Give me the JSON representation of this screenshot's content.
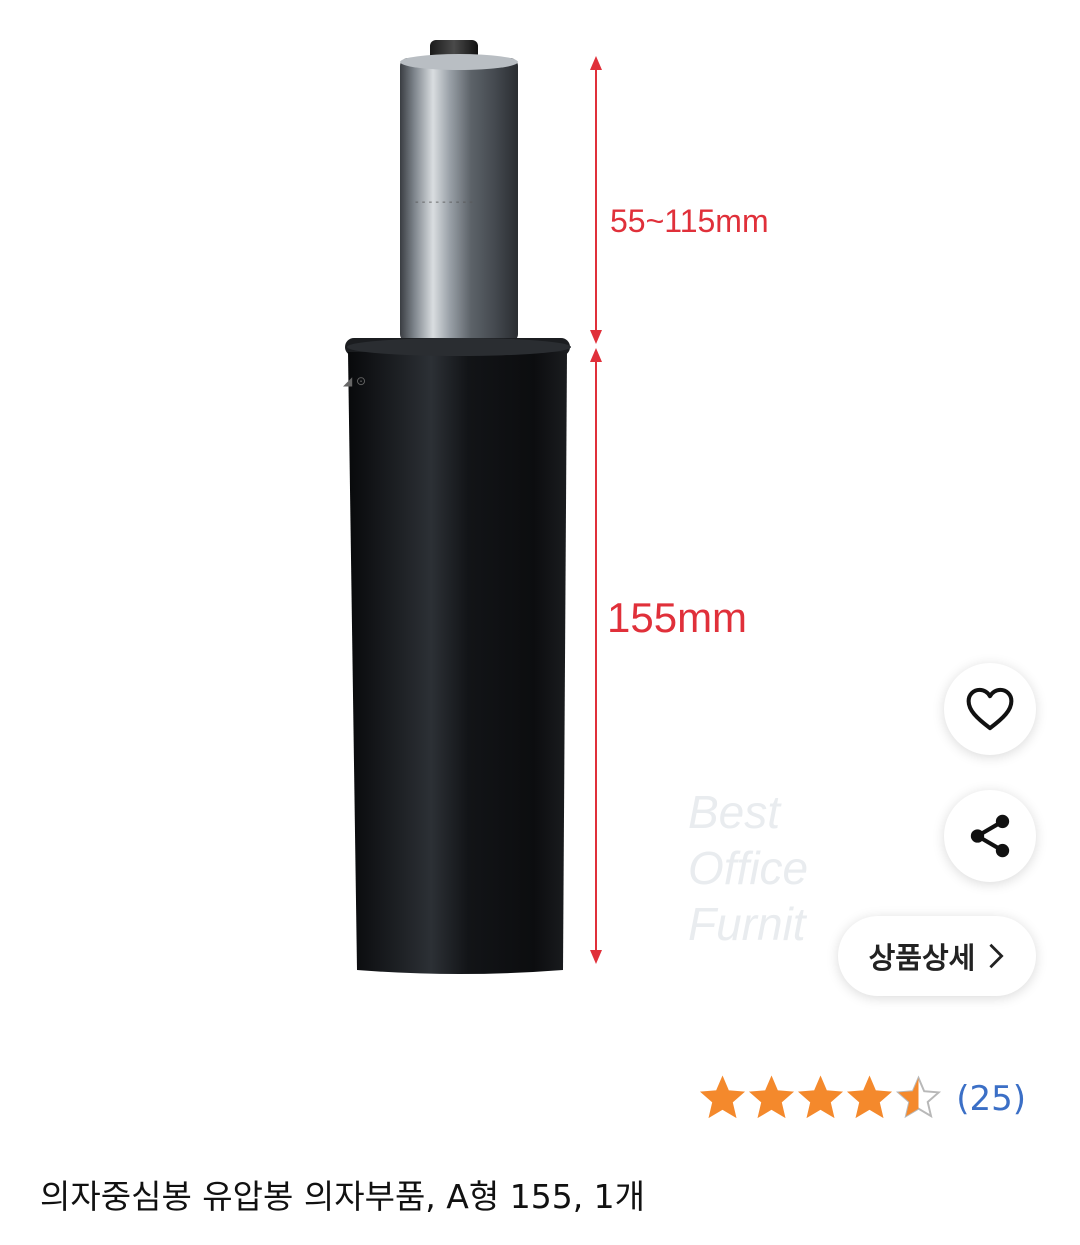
{
  "product_image": {
    "alt": "의자중심봉 유압봉 의자부품, A형 155, 1개",
    "dimension_top": "55~115mm",
    "dimension_bottom": "155mm",
    "watermark": [
      "Best",
      "Office",
      "Furnit"
    ]
  },
  "actions": {
    "wishlist_icon": "heart-icon",
    "share_icon": "share-icon",
    "detail_label": "상품상세",
    "detail_icon": "chevron-right-icon"
  },
  "rating": {
    "stars": 4.5,
    "max_stars": 5,
    "review_count": "(25)",
    "star_color": "#f4892c"
  },
  "product": {
    "title": "의자중심봉 유압봉 의자부품, A형 155, 1개"
  }
}
